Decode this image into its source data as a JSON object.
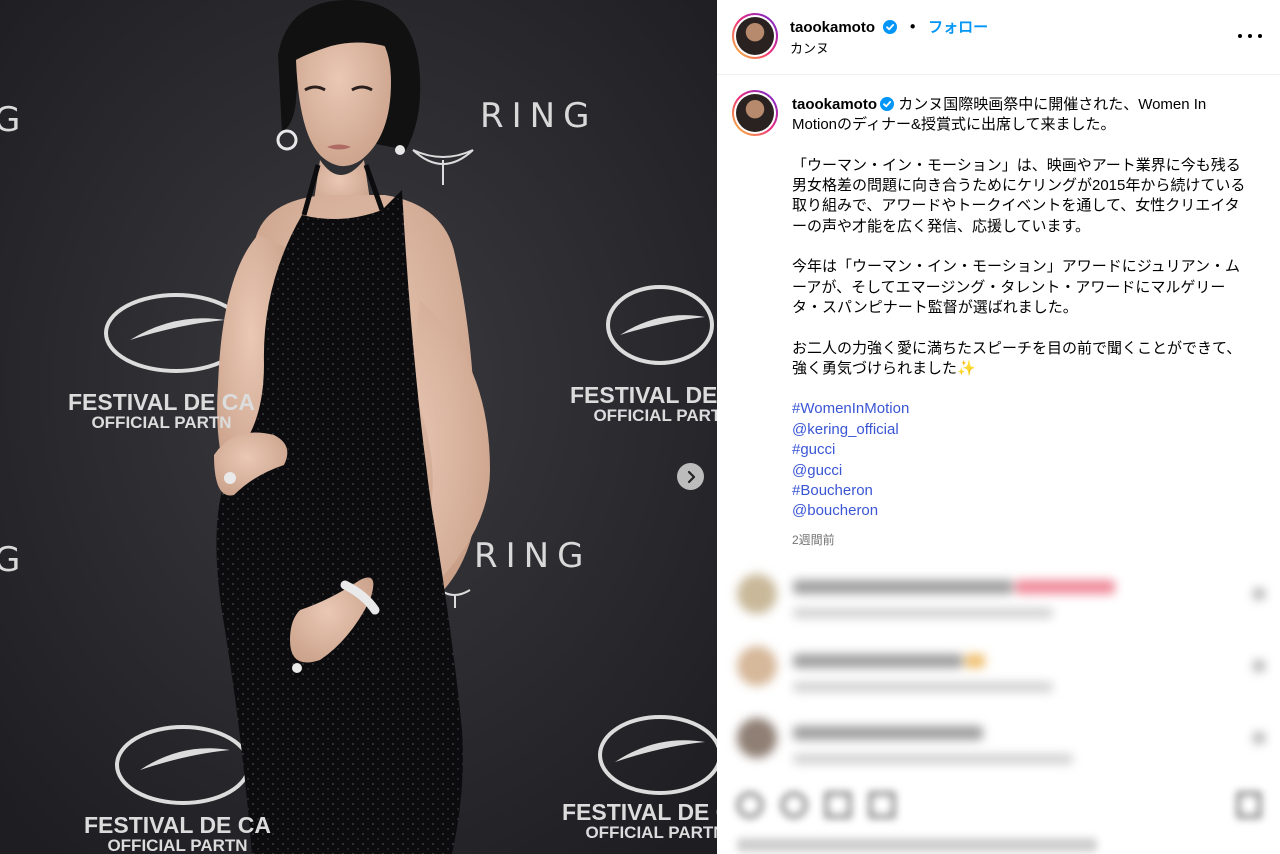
{
  "post": {
    "image_alt": "カンヌ国際映画祭 Women In Motion",
    "backdrop": {
      "brand_word_right": "RING",
      "brand_word_left": "G",
      "brand_word_lower_right": "RING",
      "brand_word_lower_left": "G",
      "festival_line1": "FESTIVAL DE CA",
      "festival_line2": "OFFICIAL PARTN"
    },
    "carousel": {
      "next_icon": "chevron-right-icon"
    }
  },
  "header": {
    "username": "taookamoto",
    "verified": true,
    "separator": "•",
    "follow_label": "フォロー",
    "location": "カンヌ"
  },
  "caption": {
    "username": "taookamoto",
    "paragraphs": [
      "カンヌ国際映画祭中に開催された、Women In Motionのディナー&授賞式に出席して来ました。",
      "「ウーマン・イン・モーション」は、映画やアート業界に今も残る男女格差の問題に向き合うためにケリングが2015年から続けている取り組みで、アワードやトークイベントを通して、女性クリエイターの声や才能を広く発信、応援しています。",
      "今年は「ウーマン・イン・モーション」アワードにジュリアン・ムーアが、そしてエマージング・タレント・アワードにマルゲリータ・スパンピナート監督が選ばれました。",
      "お二人の力強く愛に満ちたスピーチを目の前で聞くことができて、強く勇気づけられました✨"
    ],
    "tags": [
      "#WomenInMotion",
      "@kering_official",
      "#gucci",
      "@gucci",
      "#Boucheron",
      "@boucheron"
    ],
    "time": "2週間前"
  },
  "colors": {
    "link": "#3a56d4",
    "follow": "#0095f6",
    "verified": "#0095f6"
  }
}
